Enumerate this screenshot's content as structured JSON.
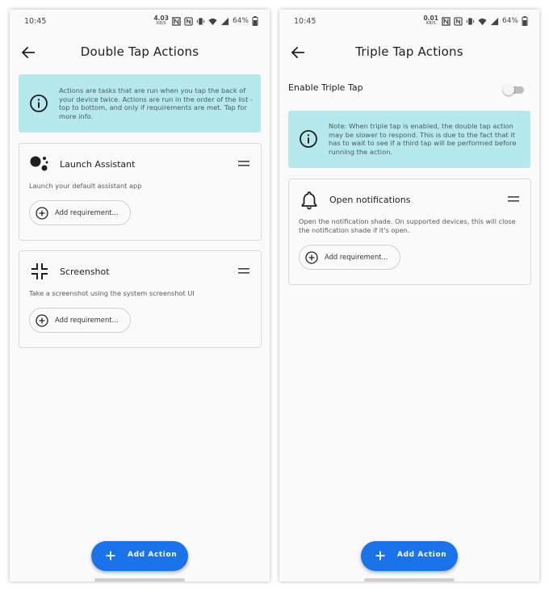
{
  "left_screen": {
    "status": {
      "time": "10:45",
      "netspeed_value": "4.03",
      "netspeed_unit": "KB/S",
      "battery": "64%"
    },
    "title": "Double Tap Actions",
    "info_banner": "Actions are tasks that are run when you tap the back of your device twice. Actions are run in the order of the list - top to bottom, and only if requirements are met. Tap for more info.",
    "actions": [
      {
        "icon": "assistant-icon",
        "title": "Launch Assistant",
        "description": "Launch your default assistant app",
        "requirement_label": "Add requirement..."
      },
      {
        "icon": "screenshot-icon",
        "title": "Screenshot",
        "description": "Take a screenshot using the system screenshot UI",
        "requirement_label": "Add requirement..."
      }
    ],
    "fab_label": "Add Action"
  },
  "right_screen": {
    "status": {
      "time": "10:45",
      "netspeed_value": "0.01",
      "netspeed_unit": "KB/S",
      "battery": "64%"
    },
    "title": "Triple Tap Actions",
    "toggle": {
      "label": "Enable Triple Tap",
      "enabled": false
    },
    "info_banner": "Note: When triple tap is enabled, the double tap action may be slower to respond. This is due to the fact that it has to wait to see if a third tap will be performed before running the action.",
    "actions": [
      {
        "icon": "bell-icon",
        "title": "Open notifications",
        "description": "Open the notification shade. On supported devices, this will close the notification shade if it's open.",
        "requirement_label": "Add requirement..."
      }
    ],
    "fab_label": "Add Action"
  },
  "colors": {
    "accent": "#1a73e8",
    "banner": "#b5e9ee",
    "card_border": "#dadada"
  }
}
